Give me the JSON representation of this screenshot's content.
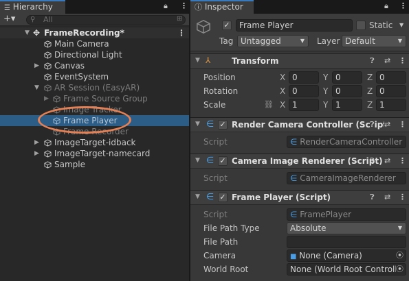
{
  "hierarchy": {
    "tab": "Hierarchy",
    "add": "+▾",
    "search_placeholder": "All",
    "scene": "FrameRecording*",
    "items": [
      {
        "label": "Main Camera"
      },
      {
        "label": "Directional Light"
      },
      {
        "label": "Canvas"
      },
      {
        "label": "EventSystem"
      },
      {
        "label": "AR Session (EasyAR)"
      },
      {
        "label": "Frame Source Group"
      },
      {
        "label": "Image Tracker"
      },
      {
        "label": "Frame Player"
      },
      {
        "label": "Frame Recorder"
      },
      {
        "label": "ImageTarget-idback"
      },
      {
        "label": "ImageTarget-namecard"
      },
      {
        "label": "Sample"
      }
    ]
  },
  "inspector": {
    "tab": "Inspector",
    "object_name": "Frame Player",
    "static_label": "Static",
    "tag_label": "Tag",
    "tag_value": "Untagged",
    "layer_label": "Layer",
    "layer_value": "Default",
    "transform": {
      "title": "Transform",
      "position_label": "Position",
      "rotation_label": "Rotation",
      "scale_label": "Scale",
      "x": "X",
      "y": "Y",
      "z": "Z",
      "position": [
        "0",
        "0",
        "0"
      ],
      "rotation": [
        "0",
        "0",
        "0"
      ],
      "scale": [
        "1",
        "1",
        "1"
      ]
    },
    "comp1": {
      "title": "Render Camera Controller (Script)",
      "script_label": "Script",
      "script_value": "RenderCameraController"
    },
    "comp2": {
      "title": "Camera Image Renderer (Script)",
      "script_label": "Script",
      "script_value": "CameraImageRenderer"
    },
    "comp3": {
      "title": "Frame Player (Script)",
      "script_label": "Script",
      "script_value": "FramePlayer",
      "file_path_type_label": "File Path Type",
      "file_path_type_value": "Absolute",
      "file_path_label": "File Path",
      "file_path_value": "",
      "camera_label": "Camera",
      "camera_value": "None (Camera)",
      "world_root_label": "World Root",
      "world_root_value": "None (World Root Controlle"
    }
  },
  "colors": {
    "selection": "#2c5d87",
    "highlight_ring": "#e48054",
    "accent_tab": "#3a79bb"
  }
}
